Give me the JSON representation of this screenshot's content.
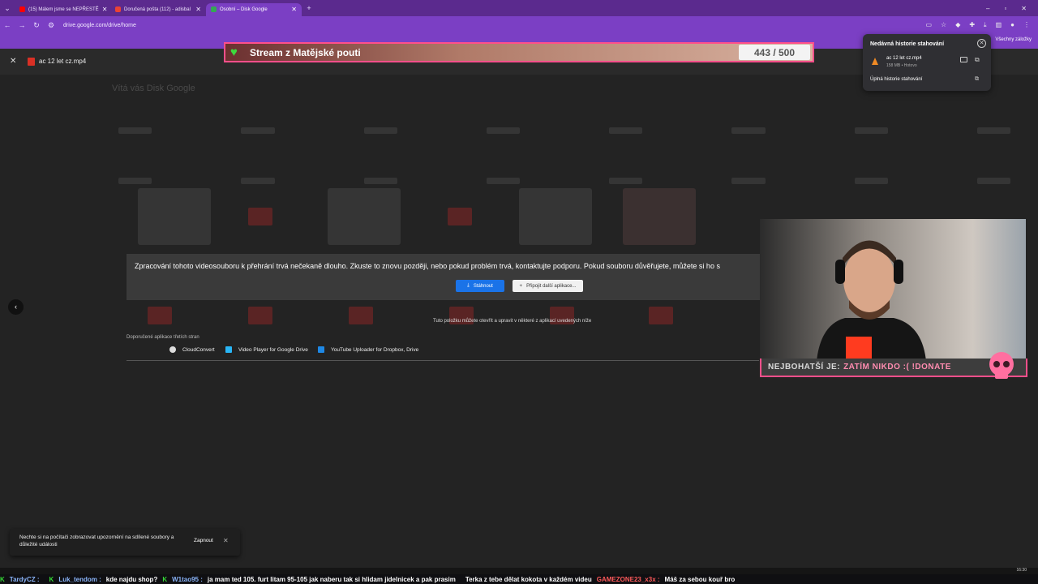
{
  "browser": {
    "tabs": [
      {
        "label": "(15) Málem jsme se NEPŘESTĚ",
        "color": "#ff0000",
        "active": false
      },
      {
        "label": "Doručená pošta (112) - adisbal",
        "color": "#ea4335",
        "active": false
      },
      {
        "label": "Osobní – Disk Google",
        "color": "#34a853",
        "active": true
      }
    ],
    "new_tab": "+",
    "url": "drive.google.com/drive/home",
    "all_bookmarks": "Všechny záložky"
  },
  "viewer": {
    "file_name": "ac 12 let cz.mp4",
    "close_symbol": "✕"
  },
  "drive": {
    "welcome": "Vítá vás Disk Google"
  },
  "stream_banner": {
    "title": "Stream z Matějské pouti",
    "counter": "443 / 500",
    "progress_fraction": 0.886
  },
  "downloads": {
    "title": "Nedávná historie stahování",
    "item_name": "ac 12 let cz.mp4",
    "item_status": "158 MB • Hotovo",
    "full_history": "Úplná historie stahování"
  },
  "error": {
    "message": "Zpracování tohoto videosouboru k přehrání trvá nečekaně dlouho. Zkuste to znovu později, nebo pokud problém trvá, kontaktujte podporu. Pokud souboru důvěřujete, můžete si ho s",
    "download_label": "Stáhnout",
    "connect_label": "Připojit další aplikace..."
  },
  "apps": {
    "hint": "Tuto položku můžete otevřít a upravit v některé z aplikací uvedených níže",
    "heading": "Doporučené aplikace třetích stran",
    "items": [
      {
        "label": "CloudConvert",
        "color": "#dddddd"
      },
      {
        "label": "Video Player for Google Drive",
        "color": "#29b6f6"
      },
      {
        "label": "YouTube Uploader for Dropbox, Drive",
        "color": "#1e88e5"
      }
    ]
  },
  "overlay": {
    "donate_label": "NEJBOHATŠÍ JE:",
    "donate_value": "ZATÍM NIKDO :( !DONATE"
  },
  "toast": {
    "text": "Nechte si na počítači zobrazovat upozornění na sdílené soubory a důležité události",
    "action": "Zapnout",
    "close": "✕"
  },
  "taskbar": {
    "time": "16:30"
  },
  "chat": [
    {
      "user": "TardyCZ :",
      "message": ""
    },
    {
      "user": "Luk_tendom :",
      "message": "kde najdu shop?"
    },
    {
      "user": "W1tao95 :",
      "message": "ja mam ted 105. furt litam 95-105 jak naberu tak si hlidam jidelnicek a pak prasim"
    },
    {
      "user": "",
      "message": "Terka z tebe dělat kokota v každém videu"
    },
    {
      "user": "GAMEZONE23_x3x :",
      "message": "Máš za sebou kouř bro"
    }
  ],
  "colors": {
    "accent": "#7b3fc4",
    "stream_border": "#ff4f8b",
    "drive_blue": "#1a73e8"
  }
}
